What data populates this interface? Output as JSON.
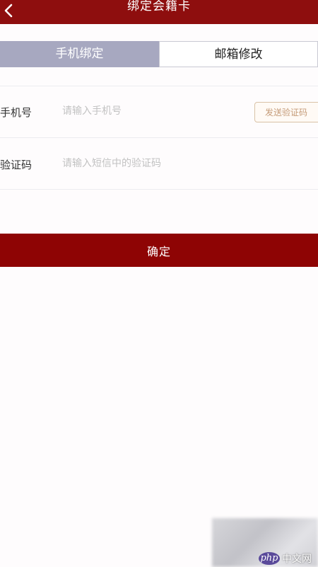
{
  "header": {
    "title": "绑定会籍卡",
    "back_icon": "chevron-left-icon"
  },
  "tabs": [
    {
      "label": "手机绑定",
      "active": true
    },
    {
      "label": "邮箱修改",
      "active": false
    }
  ],
  "form": {
    "phone": {
      "label": "手机号",
      "placeholder": "请输入手机号",
      "value": ""
    },
    "code": {
      "label": "验证码",
      "placeholder": "请输入短信中的验证码",
      "value": ""
    },
    "send_code_label": "发送验证码"
  },
  "confirm_label": "确定",
  "watermark": {
    "logo": "php",
    "text": "中文网"
  },
  "colors": {
    "header_bg": "#8e0e0e",
    "confirm_bg": "#8e0404",
    "tab_active_bg": "#a7a8c0",
    "send_code_border": "#d9c2a6",
    "send_code_text": "#c59b78"
  }
}
